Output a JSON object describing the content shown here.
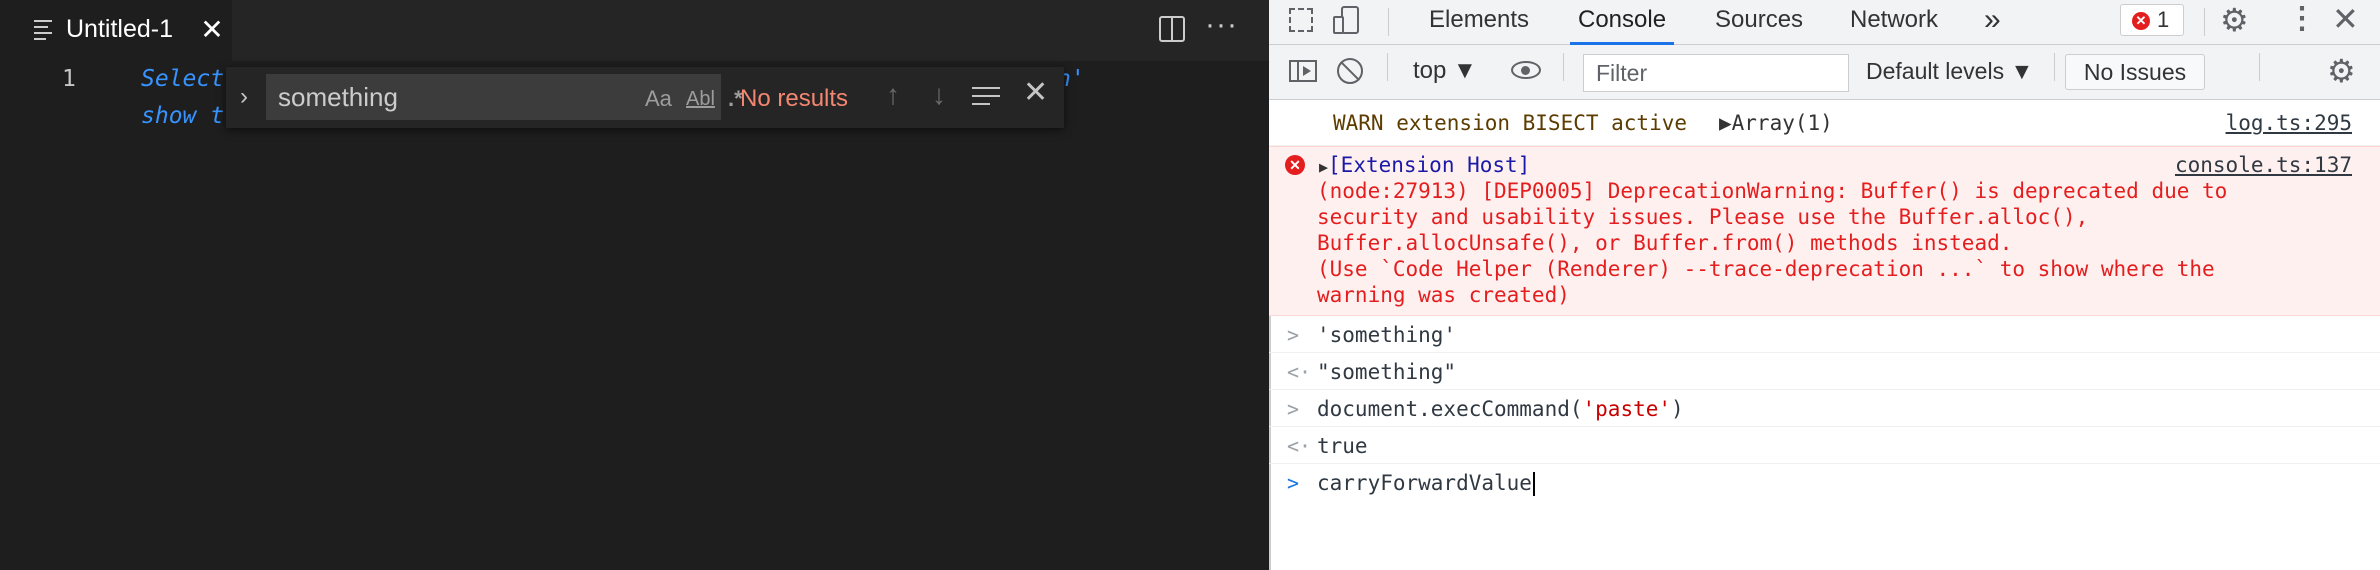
{
  "editor": {
    "tab_title": "Untitled-1",
    "close_glyph": "✕",
    "more_glyph": "···",
    "line_number": "1",
    "line1_visible": "Select",
    "line1_tail": "n'",
    "line2_visible": "show t",
    "find": {
      "toggle_glyph": "›",
      "value": "something",
      "match_case_label": "Aa",
      "whole_word_label": "Abl",
      "regex_label": ".*",
      "status": "No results",
      "prev_glyph": "↑",
      "next_glyph": "↓",
      "close_glyph": "✕"
    }
  },
  "devtools": {
    "tabs": [
      "Elements",
      "Console",
      "Sources",
      "Network"
    ],
    "active_tab": "Console",
    "overflow_glyph": "»",
    "error_count": "1",
    "kebab_glyph": "⋮",
    "close_glyph": "✕",
    "gear_glyph": "⚙",
    "context": "top ▼",
    "filter_placeholder": "Filter",
    "levels": "Default levels ▼",
    "issues": "No Issues",
    "console": {
      "warn": {
        "text": "WARN extension BISECT active",
        "array": "▶Array(1)",
        "source": "log.ts:295"
      },
      "error": {
        "head": "[Extension Host]",
        "source": "console.ts:137",
        "message": "(node:27913) [DEP0005] DeprecationWarning: Buffer() is deprecated due to\nsecurity and usability issues. Please use the Buffer.alloc(),\nBuffer.allocUnsafe(), or Buffer.from() methods instead.\n(Use `Code Helper (Renderer) --trace-deprecation ...` to show where the\nwarning was created)"
      },
      "entries": [
        {
          "prompt": ">",
          "text": "'something'",
          "kind": "input-string"
        },
        {
          "prompt": "<·",
          "text": "\"something\"",
          "kind": "output-string"
        },
        {
          "prompt": ">",
          "text_pre": "document.execCommand(",
          "text_str": "'paste'",
          "text_post": ")",
          "kind": "input-call"
        },
        {
          "prompt": "<·",
          "text": "true",
          "kind": "output-bool"
        }
      ],
      "current_input": "carryForwardValue",
      "input_prompt": ">"
    }
  },
  "colors": {
    "editor_bg": "#1e1e1e",
    "find_status": "#f48771",
    "devtools_accent": "#1a73e8",
    "error_red": "#e41e1e"
  }
}
